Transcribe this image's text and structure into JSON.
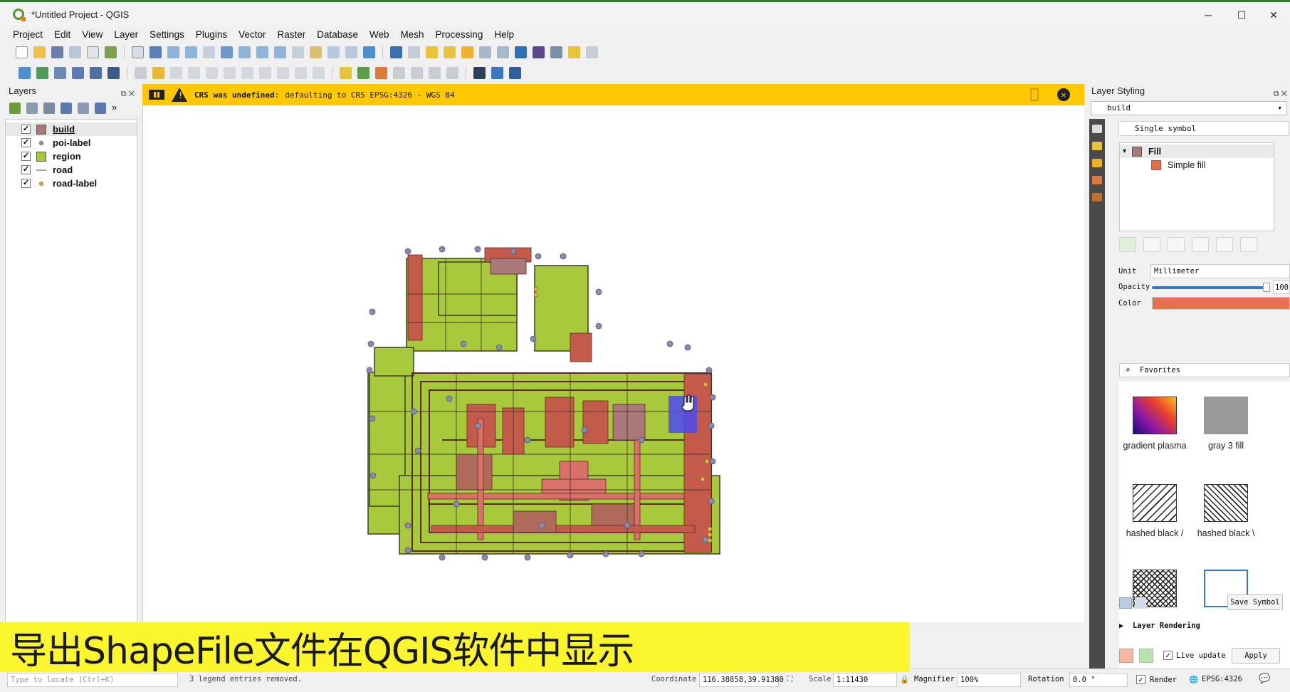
{
  "window": {
    "title": "*Untitled Project - QGIS",
    "controls": {
      "minimize": "─",
      "maximize": "☐",
      "close": "✕"
    }
  },
  "menubar": [
    "Project",
    "Edit",
    "View",
    "Layer",
    "Settings",
    "Plugins",
    "Vector",
    "Raster",
    "Database",
    "Web",
    "Mesh",
    "Processing",
    "Help"
  ],
  "layers_panel": {
    "title": "Layers",
    "layers": [
      {
        "name": "build",
        "checked": true,
        "symbol": "fill",
        "color": "#a8787a",
        "selected": true
      },
      {
        "name": "poi-label",
        "checked": true,
        "symbol": "point",
        "color": "#8a8aaa",
        "selected": false
      },
      {
        "name": "region",
        "checked": true,
        "symbol": "fill",
        "color": "#a9c93c",
        "selected": false
      },
      {
        "name": "road",
        "checked": true,
        "symbol": "line",
        "color": "#c0a0a0",
        "selected": false
      },
      {
        "name": "road-label",
        "checked": true,
        "symbol": "point",
        "color": "#c8a24a",
        "selected": false
      }
    ]
  },
  "message_bar": {
    "title": "CRS was undefined",
    "text": "defaulting to CRS EPSG:4326 - WGS 84",
    "color": "#ffc800"
  },
  "styling_panel": {
    "title": "Layer Styling",
    "layer": "build",
    "renderer": "Single symbol",
    "symbol_tree": {
      "root": "Fill",
      "root_color": "#a8787a",
      "child": "Simple fill",
      "child_color": "#e4704a"
    },
    "unit_label": "Unit",
    "unit_value": "Millimeter",
    "opacity_label": "Opacity",
    "opacity_value": "100",
    "color_label": "Color",
    "fill_color": "#e8704e",
    "favorites_label": "Favorites",
    "symbols": [
      {
        "name": "gradient plasma",
        "icon": "gradient-plasma-swatch"
      },
      {
        "name": "gray 3 fill",
        "icon": "gray-fill-swatch"
      },
      {
        "name": "hashed black /",
        "icon": "hatch-forward-swatch"
      },
      {
        "name": "hashed black \\",
        "icon": "hatch-back-swatch"
      }
    ],
    "save_symbol": "Save Symbol",
    "layer_rendering": "Layer Rendering",
    "live_update": "Live update",
    "apply": "Apply"
  },
  "statusbar": {
    "locator_placeholder": "Type to locate (Ctrl+K)",
    "message": "3 legend entries removed.",
    "coordinate_label": "Coordinate",
    "coordinate": "116.38858,39.91380",
    "scale_label": "Scale",
    "scale": "1:11430",
    "magnifier_label": "Magnifier",
    "magnifier": "100%",
    "rotation_label": "Rotation",
    "rotation": "0.0 °",
    "render_label": "Render",
    "crs": "EPSG:4326"
  },
  "caption": "导出ShapeFile文件在QGIS软件中显示",
  "colors": {
    "accent": "#2e7d32",
    "region_fill": "#a9c93c",
    "building": "#c45a4a",
    "caption_bg": "#fbf626"
  }
}
